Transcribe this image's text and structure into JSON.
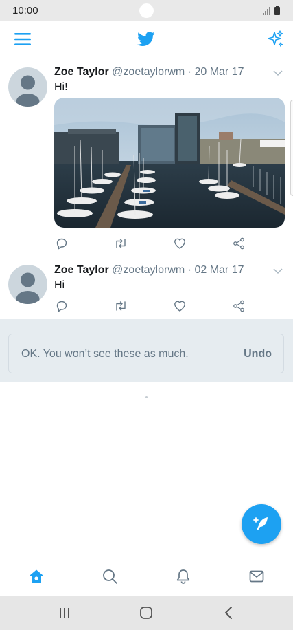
{
  "status_bar": {
    "time": "10:00"
  },
  "header": {
    "menu_icon": "hamburger-menu-icon",
    "logo_icon": "twitter-bird-icon",
    "sparkle_icon": "sparkle-icon",
    "accent_color": "#1da1f2"
  },
  "tweets": [
    {
      "name": "Zoe Taylor",
      "handle": "@zoetaylorwm",
      "date": "· 20 Mar 17",
      "text": "Hi!",
      "has_media": true
    },
    {
      "name": "Zoe Taylor",
      "handle": "@zoetaylorwm",
      "date": "· 02 Mar 17",
      "text": "Hi",
      "has_media": false
    }
  ],
  "toast": {
    "message": "OK. You won’t see these as much.",
    "undo_label": "Undo"
  },
  "fab": {
    "icon": "compose-tweet-icon"
  },
  "tabbar": {
    "items": [
      {
        "icon": "home-icon",
        "active": true
      },
      {
        "icon": "search-icon",
        "active": false
      },
      {
        "icon": "notifications-bell-icon",
        "active": false
      },
      {
        "icon": "messages-envelope-icon",
        "active": false
      }
    ]
  },
  "nav": {
    "items": [
      "recent-apps-icon",
      "home-button-icon",
      "back-icon"
    ]
  }
}
